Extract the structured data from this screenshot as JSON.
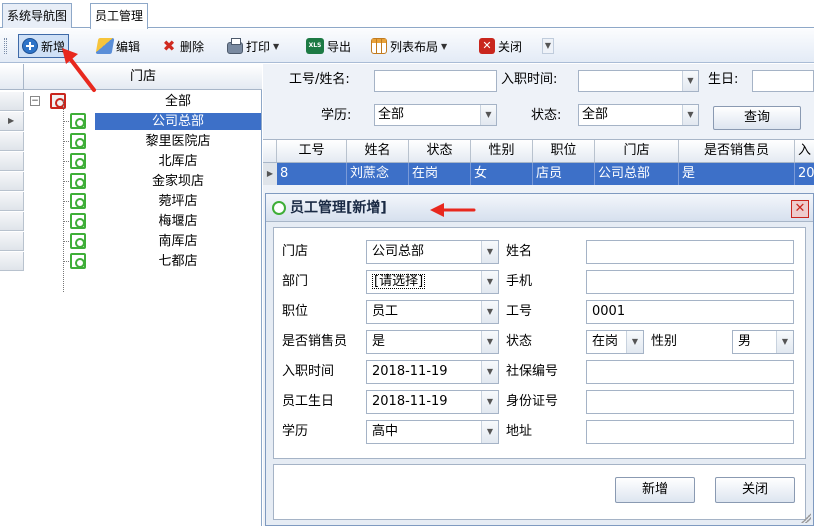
{
  "tabs": [
    {
      "label": "系统导航图"
    },
    {
      "label": "员工管理"
    }
  ],
  "toolbar": {
    "add": "新增",
    "edit": "编辑",
    "delete": "删除",
    "print": "打印",
    "export": "导出",
    "layout": "列表布局",
    "close": "关闭"
  },
  "tree": {
    "header": "门店",
    "root": "全部",
    "items": [
      "公司总部",
      "黎里医院店",
      "北厍店",
      "金家坝店",
      "菀坪店",
      "梅堰店",
      "南厍店",
      "七都店"
    ],
    "selected_index": 0
  },
  "filters": {
    "id_name_label": "工号/姓名:",
    "hire_label": "入职时间:",
    "birth_label": "生日:",
    "edu_label": "学历:",
    "edu_value": "全部",
    "status_label": "状态:",
    "status_value": "全部",
    "query_button": "查询"
  },
  "grid": {
    "columns": [
      "工号",
      "姓名",
      "状态",
      "性别",
      "职位",
      "门店",
      "是否销售员",
      "入"
    ],
    "row": [
      "8",
      "刘蔗念",
      "在岗",
      "女",
      "店员",
      "公司总部",
      "是",
      "20"
    ]
  },
  "dialog": {
    "title": "员工管理[新增]",
    "fields": {
      "store_label": "门店",
      "store_value": "公司总部",
      "dept_label": "部门",
      "dept_value": "[请选择]",
      "position_label": "职位",
      "position_value": "员工",
      "sales_label": "是否销售员",
      "sales_value": "是",
      "hire_label": "入职时间",
      "hire_value": "2018-11-19",
      "birth_label": "员工生日",
      "birth_value": "2018-11-19",
      "edu_label": "学历",
      "edu_value": "高中",
      "name_label": "姓名",
      "name_value": "",
      "phone_label": "手机",
      "phone_value": "",
      "id_label": "工号",
      "id_value": "0001",
      "status_label": "状态",
      "status_value": "在岗",
      "gender_label": "性别",
      "gender_value": "男",
      "social_label": "社保编号",
      "social_value": "",
      "idcard_label": "身份证号",
      "idcard_value": "",
      "address_label": "地址",
      "address_value": ""
    },
    "add_button": "新增",
    "close_button": "关闭"
  },
  "colors": {
    "selection": "#3d70c8",
    "annotation_arrow": "#e8281e"
  }
}
